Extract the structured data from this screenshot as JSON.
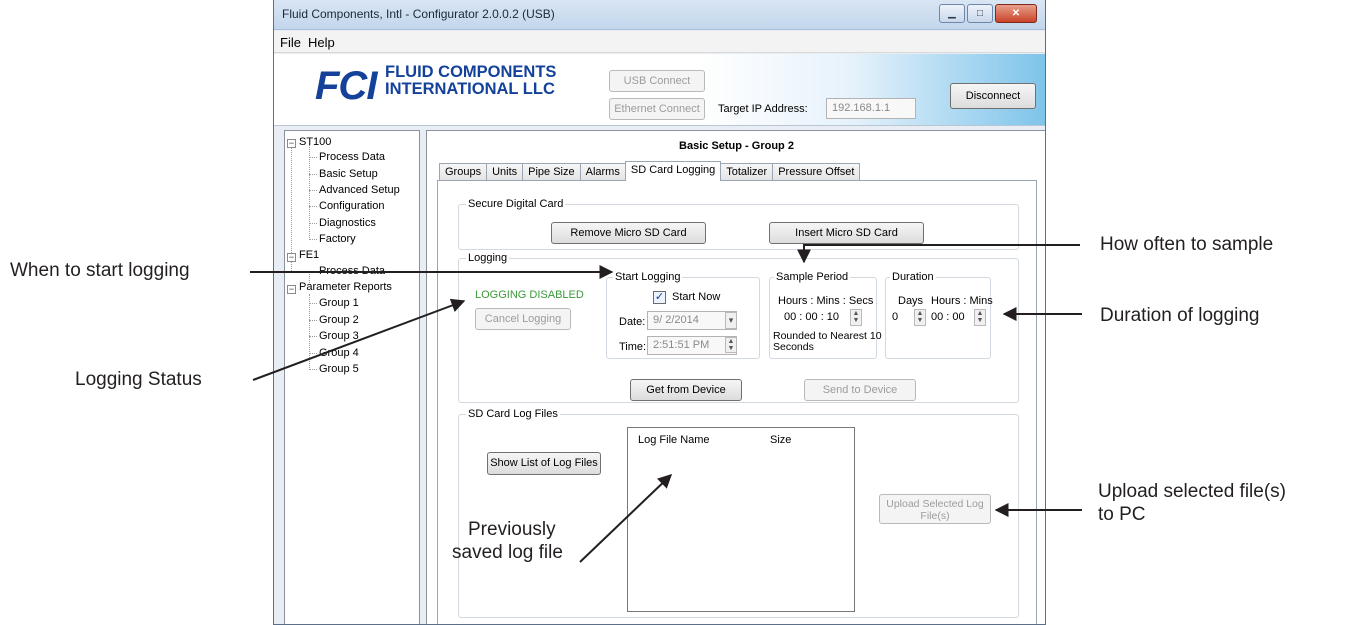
{
  "window": {
    "title": "Fluid Components, Intl - Configurator 2.0.0.2 (USB)",
    "menu": [
      "File",
      "Help"
    ],
    "caption_buttons": [
      "minimize-icon",
      "maximize-icon",
      "close-icon"
    ]
  },
  "header": {
    "logo_mark": "FCI",
    "logo_line1": "FLUID COMPONENTS",
    "logo_line2": "INTERNATIONAL LLC",
    "usb_connect": "USB Connect",
    "ethernet_connect": "Ethernet Connect",
    "target_ip_label": "Target IP Address:",
    "target_ip_value": "192.168.1.1",
    "disconnect": "Disconnect"
  },
  "tree": {
    "nodes": [
      {
        "label": "ST100",
        "expander": "−"
      },
      {
        "label": "Process Data"
      },
      {
        "label": "Basic Setup"
      },
      {
        "label": "Advanced Setup"
      },
      {
        "label": "Configuration"
      },
      {
        "label": "Diagnostics"
      },
      {
        "label": "Factory"
      },
      {
        "label": "FE1",
        "expander": "−"
      },
      {
        "label": "Process Data"
      },
      {
        "label": "Parameter Reports",
        "expander": "−"
      },
      {
        "label": "Group 1"
      },
      {
        "label": "Group 2"
      },
      {
        "label": "Group 3"
      },
      {
        "label": "Group 4"
      },
      {
        "label": "Group 5"
      }
    ]
  },
  "main": {
    "title": "Basic Setup - Group 2",
    "tabs": [
      "Groups",
      "Units",
      "Pipe Size",
      "Alarms",
      "SD Card Logging",
      "Totalizer",
      "Pressure Offset"
    ],
    "active_tab": "SD Card Logging"
  },
  "sd_card": {
    "group_title": "Secure Digital Card",
    "remove_button": "Remove Micro SD Card",
    "insert_button": "Insert Micro SD Card"
  },
  "logging": {
    "group_title": "Logging",
    "status": "LOGGING DISABLED",
    "status_color": "#3a9a3a",
    "cancel_button": "Cancel Logging",
    "start_title": "Start Logging",
    "start_now_label": "Start Now",
    "start_now_checked": true,
    "check_glyph": "✓",
    "date_label": "Date:",
    "date_value": "9/ 2/2014",
    "time_label": "Time:",
    "time_value": "2:51:51 PM",
    "sample_title": "Sample Period",
    "sample_units": "Hours : Mins : Secs",
    "sample_value": "00 : 00 : 10",
    "sample_note_line1": "Rounded to Nearest 10",
    "sample_note_line2": "Seconds",
    "duration_title": "Duration",
    "days_label": "Days",
    "hours_mins_label": "Hours : Mins",
    "days_value": "0",
    "hours_mins_value": "00 : 00",
    "get_button": "Get from Device",
    "send_button": "Send to Device"
  },
  "log_files": {
    "group_title": "SD Card Log Files",
    "show_button": "Show List of Log Files",
    "col_name": "Log File Name",
    "col_size": "Size",
    "upload_button_line1": "Upload Selected Log",
    "upload_button_line2": "File(s)"
  },
  "annotations": {
    "when_to_start": "When to start logging",
    "how_often": "How often to sample",
    "duration": "Duration of logging",
    "status": "Logging Status",
    "upload_line1": "Upload selected file(s)",
    "upload_line2": "to PC",
    "previous_line1": "Previously",
    "previous_line2": "saved log file"
  }
}
